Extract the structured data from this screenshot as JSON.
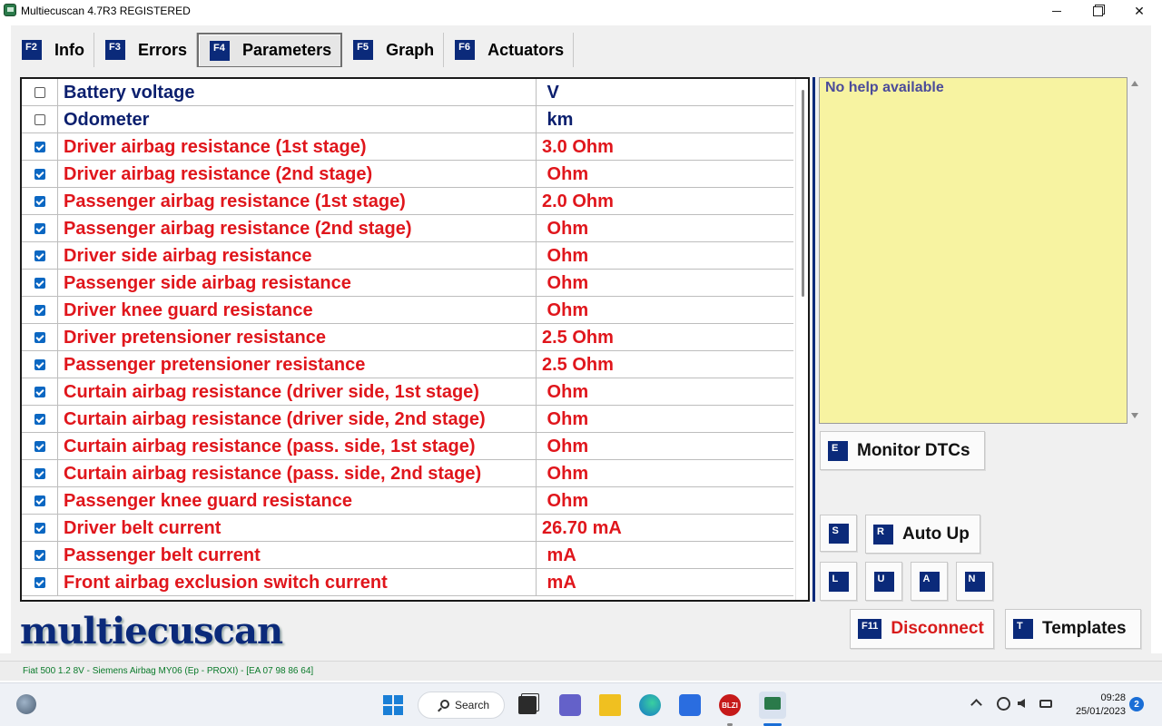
{
  "window": {
    "title": "Multiecuscan 4.7R3 REGISTERED",
    "close_glyph": "✕"
  },
  "tabs": [
    {
      "key": "F2",
      "label": "Info",
      "active": false
    },
    {
      "key": "F3",
      "label": "Errors",
      "active": false
    },
    {
      "key": "F4",
      "label": "Parameters",
      "active": true
    },
    {
      "key": "F5",
      "label": "Graph",
      "active": false
    },
    {
      "key": "F6",
      "label": "Actuators",
      "active": false
    }
  ],
  "parameters": [
    {
      "checked": false,
      "name": "Battery voltage",
      "value": " V",
      "color": "blue"
    },
    {
      "checked": false,
      "name": "Odometer",
      "value": " km",
      "color": "blue"
    },
    {
      "checked": true,
      "name": "Driver airbag resistance (1st stage)",
      "value": "3.0 Ohm",
      "color": "red"
    },
    {
      "checked": true,
      "name": "Driver airbag resistance (2nd stage)",
      "value": " Ohm",
      "color": "red"
    },
    {
      "checked": true,
      "name": "Passenger airbag resistance (1st stage)",
      "value": "2.0 Ohm",
      "color": "red"
    },
    {
      "checked": true,
      "name": "Passenger airbag resistance (2nd stage)",
      "value": " Ohm",
      "color": "red"
    },
    {
      "checked": true,
      "name": "Driver side airbag resistance",
      "value": " Ohm",
      "color": "red"
    },
    {
      "checked": true,
      "name": "Passenger side airbag resistance",
      "value": " Ohm",
      "color": "red"
    },
    {
      "checked": true,
      "name": "Driver knee guard resistance",
      "value": " Ohm",
      "color": "red"
    },
    {
      "checked": true,
      "name": "Driver pretensioner resistance",
      "value": "2.5 Ohm",
      "color": "red"
    },
    {
      "checked": true,
      "name": "Passenger pretensioner resistance",
      "value": "2.5 Ohm",
      "color": "red"
    },
    {
      "checked": true,
      "name": "Curtain airbag resistance (driver side, 1st stage)",
      "value": " Ohm",
      "color": "red"
    },
    {
      "checked": true,
      "name": "Curtain airbag resistance (driver side, 2nd stage)",
      "value": " Ohm",
      "color": "red"
    },
    {
      "checked": true,
      "name": "Curtain airbag resistance (pass. side, 1st stage)",
      "value": " Ohm",
      "color": "red"
    },
    {
      "checked": true,
      "name": "Curtain airbag resistance (pass. side, 2nd stage)",
      "value": " Ohm",
      "color": "red"
    },
    {
      "checked": true,
      "name": "Passenger knee guard resistance",
      "value": " Ohm",
      "color": "red"
    },
    {
      "checked": true,
      "name": "Driver belt current",
      "value": "26.70 mA",
      "color": "red"
    },
    {
      "checked": true,
      "name": "Passenger belt current",
      "value": " mA",
      "color": "red"
    },
    {
      "checked": true,
      "name": "Front airbag exclusion switch current",
      "value": " mA",
      "color": "red"
    }
  ],
  "help": {
    "text": "No help available"
  },
  "buttons": {
    "monitor_key": "E",
    "monitor_label": "Monitor DTCs",
    "s_key": "S",
    "autoup_key": "R",
    "autoup_label": "Auto Up",
    "l_key": "L",
    "u_key": "U",
    "a_key": "A",
    "n_key": "N",
    "disconnect_key": "F11",
    "disconnect_label": "Disconnect",
    "templates_key": "T",
    "templates_label": "Templates"
  },
  "logo": {
    "text": "multiecuscan"
  },
  "status": {
    "text": "Fiat 500 1.2 8V - Siemens Airbag MY06 (Ep - PROXI) - [EA 07 98 86 64]"
  },
  "taskbar": {
    "search_label": "Search",
    "blz_label": "BLZI",
    "time": "09:28",
    "date": "25/01/2023",
    "notifications": "2"
  },
  "colors": {
    "blue": "#0b1f6e",
    "red": "#e0161c",
    "accent": "#0b2a7a",
    "help_bg": "#f7f3a1"
  }
}
